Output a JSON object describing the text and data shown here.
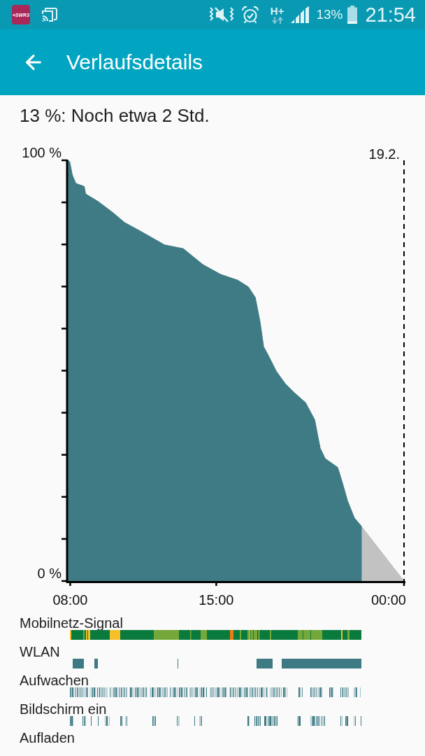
{
  "status_bar": {
    "app_icon_label": "»SWR3",
    "network_type": "H+",
    "battery": "13%",
    "time": "21:54"
  },
  "app_bar": {
    "title": "Verlaufsdetails"
  },
  "summary": "13 %: Noch etwa 2 Std.",
  "chart": {
    "chart_data": {
      "type": "area",
      "x": [
        7.9,
        7.98,
        8.1,
        8.27,
        8.67,
        8.74,
        9.34,
        10.01,
        10.61,
        11.35,
        12.52,
        13.42,
        14.36,
        15.2,
        16.03,
        16.54,
        16.87,
        17.1,
        17.27,
        17.54,
        17.87,
        18.31,
        18.71,
        19.28,
        19.72,
        19.98,
        20.22,
        20.82,
        21.05,
        21.29,
        21.62,
        21.96,
        22,
        24
      ],
      "series": [
        {
          "color": "#3f7b84",
          "values": [
            100,
            99.6,
            96.5,
            94.5,
            93.8,
            92,
            90.2,
            87.7,
            85.2,
            83.2,
            79.9,
            79,
            75.2,
            72.9,
            71.5,
            69.9,
            67.4,
            61.6,
            55.7,
            53.2,
            49.9,
            46.9,
            44.9,
            42.4,
            38.3,
            31.6,
            29.1,
            27,
            23.3,
            19.1,
            15,
            13,
            null,
            null
          ]
        },
        {
          "color": "#c2c2c2",
          "values": [
            null,
            null,
            null,
            null,
            null,
            null,
            null,
            null,
            null,
            null,
            null,
            null,
            null,
            null,
            null,
            null,
            null,
            null,
            null,
            null,
            null,
            null,
            null,
            null,
            null,
            null,
            null,
            null,
            null,
            null,
            null,
            null,
            12.75,
            0
          ]
        }
      ],
      "xlim": [
        7.85,
        24
      ],
      "ylim": [
        0,
        100
      ],
      "xticks": [
        {
          "value": 8,
          "label": "08:00"
        },
        {
          "value": 15,
          "label": "15:00"
        },
        {
          "value": 24,
          "label": "00:00"
        }
      ],
      "yticks": [
        {
          "value": 0,
          "label": "0 %"
        },
        {
          "value": 100,
          "label": "100 %"
        }
      ],
      "annotations": [
        {
          "text": "19.2."
        }
      ]
    }
  },
  "timelines": [
    {
      "label": "Mobilnetz-Signal",
      "kind": "signal"
    },
    {
      "label": "WLAN",
      "kind": "wlan"
    },
    {
      "label": "Aufwachen",
      "kind": "wake"
    },
    {
      "label": "Bildschirm ein",
      "kind": "screen"
    },
    {
      "label": "Aufladen",
      "kind": "charging"
    }
  ]
}
